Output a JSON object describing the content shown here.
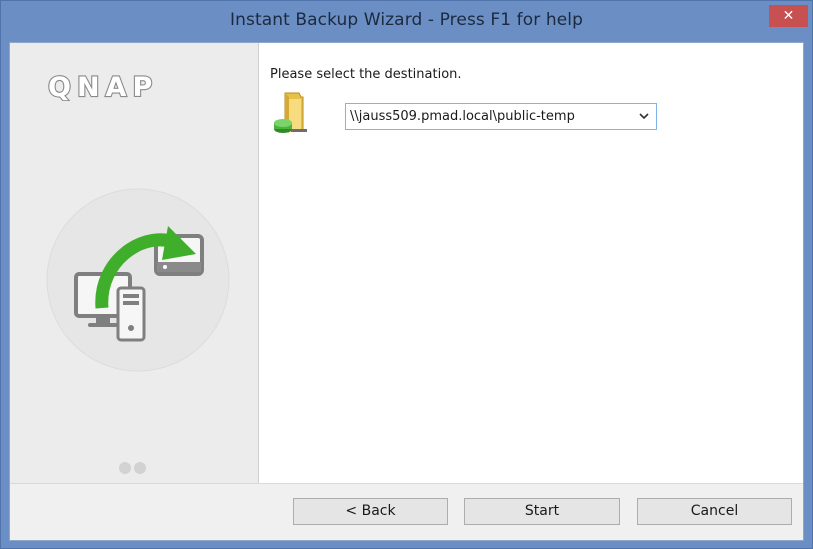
{
  "window": {
    "title": "Instant Backup Wizard - Press F1 for help",
    "close_label": "✕"
  },
  "sidebar": {
    "logo_text": "QNAP",
    "illustration": "pc-to-nas-backup-icon",
    "page_indicator": {
      "pages": 2,
      "current": 1
    }
  },
  "main": {
    "prompt": "Please select the destination.",
    "destination_icon": "network-folder-icon",
    "destination": {
      "selected": "\\\\jauss509.pmad.local\\public-temp"
    }
  },
  "buttons": {
    "back": "< Back",
    "start": "Start",
    "cancel": "Cancel"
  },
  "colors": {
    "titlebar": "#6b8ec4",
    "close_button": "#c75050",
    "accent_green": "#3fae2a",
    "dropdown_border": "#7eb4ea"
  }
}
